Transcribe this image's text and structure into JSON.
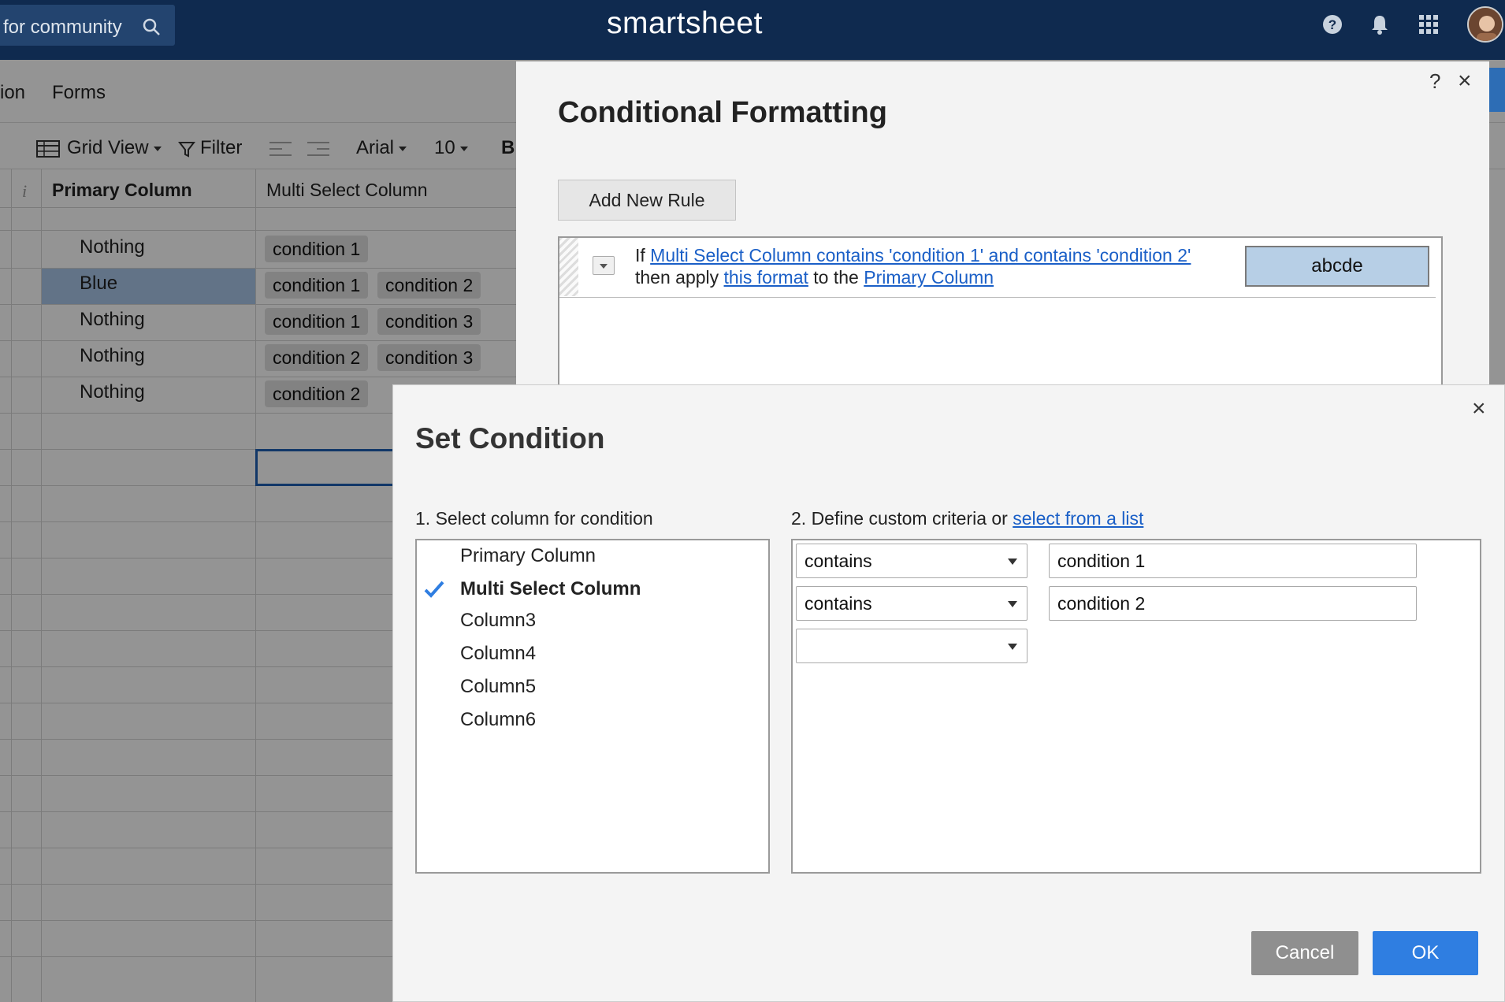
{
  "header": {
    "search_text": "for community",
    "logo": "smartsheet",
    "icons": [
      "search-icon",
      "help-icon",
      "bell-icon",
      "apps-grid-icon",
      "avatar"
    ]
  },
  "tabs": {
    "partial_left": "ion",
    "forms": "Forms"
  },
  "toolbar": {
    "grid_view": "Grid View",
    "filter": "Filter",
    "font": "Arial",
    "font_size": "10",
    "bold": "B"
  },
  "grid": {
    "info_icon": "i",
    "columns": [
      "Primary Column",
      "Multi Select Column"
    ],
    "rows": [
      {
        "primary": "Nothing",
        "multi": [
          "condition 1"
        ]
      },
      {
        "primary": "Blue",
        "multi": [
          "condition 1",
          "condition 2"
        ]
      },
      {
        "primary": "Nothing",
        "multi": [
          "condition 1",
          "condition 3"
        ]
      },
      {
        "primary": "Nothing",
        "multi": [
          "condition 2",
          "condition 3"
        ]
      },
      {
        "primary": "Nothing",
        "multi": [
          "condition 2"
        ]
      }
    ]
  },
  "cf_panel": {
    "title": "Conditional Formatting",
    "help": "?",
    "close": "×",
    "add_rule": "Add New Rule",
    "rule": {
      "if": "If",
      "condition_link": "Multi Select Column contains 'condition 1' and contains 'condition 2'",
      "then_apply": "then apply",
      "format_link": "this format",
      "to_the": "to the",
      "column_link": "Primary Column",
      "preview": "abcde"
    }
  },
  "dialog": {
    "title": "Set Condition",
    "close": "×",
    "step1_label": "1. Select column for condition",
    "step2_label": "2. Define custom criteria or",
    "step2_link": "select from a list",
    "columns": [
      "Primary Column",
      "Multi Select Column",
      "Column3",
      "Column4",
      "Column5",
      "Column6"
    ],
    "selected_column": "Multi Select Column",
    "criteria": [
      {
        "operator": "contains",
        "value": "condition 1"
      },
      {
        "operator": "contains",
        "value": "condition 2"
      },
      {
        "operator": "",
        "value": ""
      }
    ],
    "cancel": "Cancel",
    "ok": "OK"
  },
  "colors": {
    "header_bg": "#0f2a4f",
    "link": "#1a5fc7",
    "ok_button": "#2f7ee1",
    "cancel_button": "#8f8f8f",
    "highlight_cell": "#b7cfe6"
  }
}
